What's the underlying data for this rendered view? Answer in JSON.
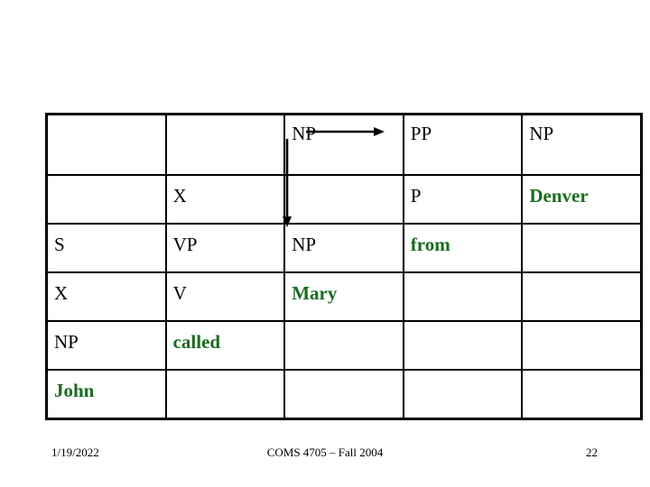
{
  "slide": {
    "background_color": "#ffffff",
    "nonterminal_color": "#000000",
    "word_color": "#1a6b1d",
    "border_color": "#000000"
  },
  "chart": {
    "name": "parse-chart",
    "rows": 6,
    "cols": 5,
    "cells": [
      [
        {
          "text": "",
          "kind": "empty"
        },
        {
          "text": "",
          "kind": "empty"
        },
        {
          "text": "NP",
          "kind": "nt"
        },
        {
          "text": "PP",
          "kind": "nt"
        },
        {
          "text": "NP",
          "kind": "nt"
        }
      ],
      [
        {
          "text": "",
          "kind": "empty"
        },
        {
          "text": "X",
          "kind": "nt"
        },
        {
          "text": "",
          "kind": "empty"
        },
        {
          "text": "P",
          "kind": "nt"
        },
        {
          "text": "Denver",
          "kind": "word"
        }
      ],
      [
        {
          "text": "S",
          "kind": "nt"
        },
        {
          "text": "VP",
          "kind": "nt"
        },
        {
          "text": "NP",
          "kind": "nt"
        },
        {
          "text": "from",
          "kind": "word"
        },
        {
          "text": "",
          "kind": "empty"
        }
      ],
      [
        {
          "text": "X",
          "kind": "nt"
        },
        {
          "text": "V",
          "kind": "nt"
        },
        {
          "text": "Mary",
          "kind": "word"
        },
        {
          "text": "",
          "kind": "empty"
        },
        {
          "text": "",
          "kind": "empty"
        }
      ],
      [
        {
          "text": "NP",
          "kind": "nt"
        },
        {
          "text": "called",
          "kind": "word"
        },
        {
          "text": "",
          "kind": "empty"
        },
        {
          "text": "",
          "kind": "empty"
        },
        {
          "text": "",
          "kind": "empty"
        }
      ],
      [
        {
          "text": "John",
          "kind": "word"
        },
        {
          "text": "",
          "kind": "empty"
        },
        {
          "text": "",
          "kind": "empty"
        },
        {
          "text": "",
          "kind": "empty"
        },
        {
          "text": "",
          "kind": "empty"
        }
      ]
    ]
  },
  "annotations": {
    "arrow_right": {
      "name": "arrow-np-to-pp",
      "from_label": "NP",
      "to_label": "PP"
    },
    "arrow_down": {
      "name": "arrow-np-to-np",
      "from_label": "NP",
      "to_label": "NP"
    }
  },
  "footer": {
    "date": "1/19/2022",
    "center": "COMS 4705 – Fall 2004",
    "page": "22"
  }
}
